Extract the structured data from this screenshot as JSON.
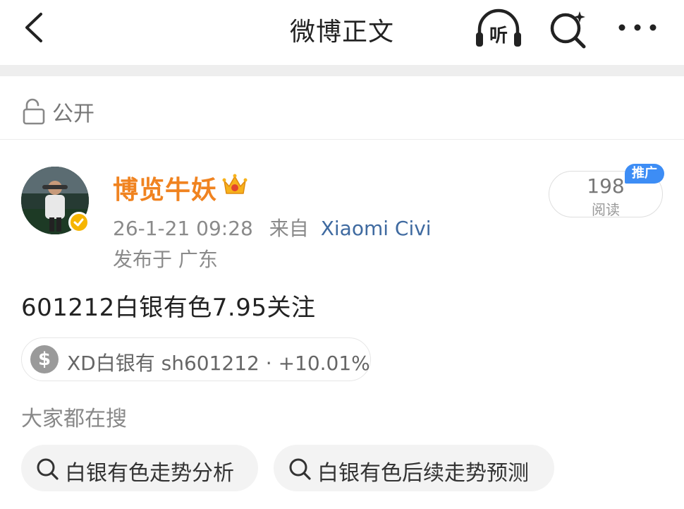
{
  "header": {
    "title": "微博正文",
    "listen_label": "听"
  },
  "visibility": {
    "label": "公开"
  },
  "author": {
    "name": "博览牛妖",
    "timestamp": "26-1-21 09:28",
    "source_prefix": "来自",
    "source_app": "Xiaomi Civi",
    "location": "发布于 广东"
  },
  "read_stats": {
    "count": "198",
    "label": "阅读",
    "promo_badge": "推广"
  },
  "post": {
    "text": "601212白银有色7.95关注"
  },
  "stock_chip": {
    "icon": "$",
    "text": "XD白银有 sh601212 · +10.01%"
  },
  "search": {
    "heading": "大家都在搜",
    "suggestions": [
      "白银有色走势分析",
      "白银有色后续走势预测"
    ]
  },
  "colors": {
    "author_name": "#f08320",
    "source_link": "#3f6aa0",
    "promo_badge": "#3d8df5",
    "verified_badge": "#f6b500"
  }
}
